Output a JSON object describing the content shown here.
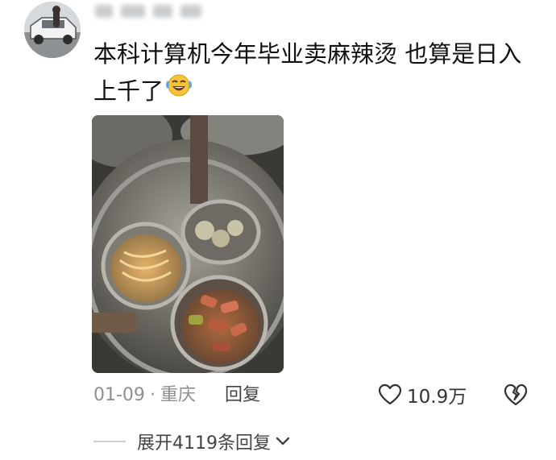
{
  "comment": {
    "text_line1": "本科计算机今年毕业卖麻辣烫 也算是日入",
    "text_line2": "上千了",
    "emoji": "rofl-emoji",
    "date": "01-09",
    "separator": "·",
    "location": "重庆",
    "reply_label": "回复",
    "like_count": "10.9万",
    "expand_label": "展开4119条回复"
  },
  "icons": {
    "like": "heart-outline-icon",
    "dislike": "broken-heart-icon",
    "expand": "chevron-down-icon"
  },
  "colors": {
    "meta_gray": "#8f8f8f",
    "text": "#111111",
    "emoji_yellow": "#f6c33a"
  }
}
